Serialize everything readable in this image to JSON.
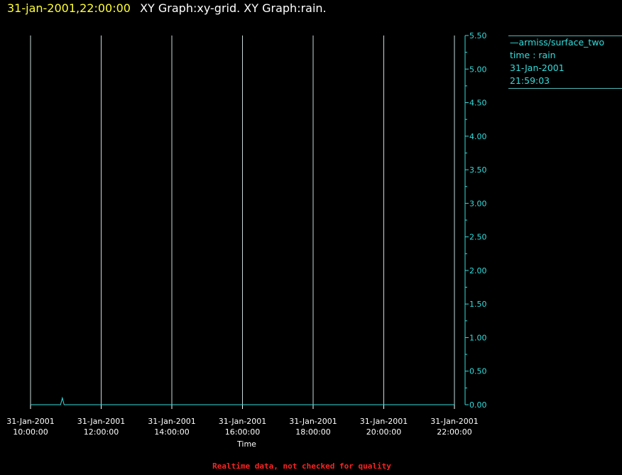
{
  "header": {
    "timestamp": "31-jan-2001,22:00:00",
    "title": "XY Graph:xy-grid.  XY Graph:rain."
  },
  "legend": {
    "series_label": "—armiss/surface_two",
    "axes_label": "time : rain",
    "date": "31-Jan-2001",
    "time": "21:59:03"
  },
  "footer": {
    "note": "Realtime data, not checked for quality"
  },
  "colors": {
    "background": "#000000",
    "grid": "#c8d8d8",
    "series": "#33dddd",
    "header_time": "#ffff33",
    "footer": "#ff2222"
  },
  "chart_data": {
    "type": "line",
    "xlabel": "Time",
    "ylabel": "",
    "x_ticks": [
      {
        "date": "31-Jan-2001",
        "time": "10:00:00"
      },
      {
        "date": "31-Jan-2001",
        "time": "12:00:00"
      },
      {
        "date": "31-Jan-2001",
        "time": "14:00:00"
      },
      {
        "date": "31-Jan-2001",
        "time": "16:00:00"
      },
      {
        "date": "31-Jan-2001",
        "time": "18:00:00"
      },
      {
        "date": "31-Jan-2001",
        "time": "20:00:00"
      },
      {
        "date": "31-Jan-2001",
        "time": "22:00:00"
      }
    ],
    "xlim": [
      "31-Jan-2001 10:00:00",
      "31-Jan-2001 22:00:00"
    ],
    "ylim": [
      0,
      5.5
    ],
    "y_ticks": [
      "0.00",
      "0.50",
      "1.00",
      "1.50",
      "2.00",
      "2.50",
      "3.00",
      "3.50",
      "4.00",
      "4.50",
      "5.00",
      "5.50"
    ],
    "y_axis_side": "right",
    "grid": "vertical",
    "series": [
      {
        "name": "armiss/surface_two",
        "points": [
          {
            "t": "31-Jan-2001 10:00:00",
            "y": 0.0
          },
          {
            "t": "31-Jan-2001 10:51:00",
            "y": 0.0
          },
          {
            "t": "31-Jan-2001 10:54:00",
            "y": 0.1
          },
          {
            "t": "31-Jan-2001 10:57:00",
            "y": 0.0
          },
          {
            "t": "31-Jan-2001 22:00:00",
            "y": 0.0
          }
        ]
      }
    ]
  }
}
